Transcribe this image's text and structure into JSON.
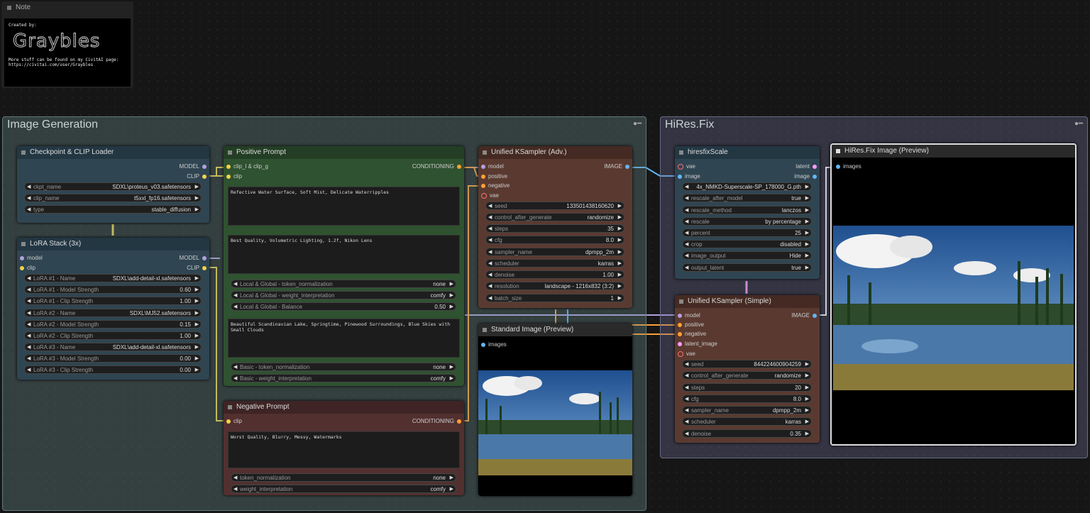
{
  "colors": {
    "clip": "#f2d24a",
    "model": "#b4a0e0",
    "conditioning": "#ffa030",
    "image": "#64b5f6",
    "latent": "#ff9cf9",
    "vae": "#ff6e6e"
  },
  "note": {
    "title": "Note",
    "created_by": "Created by:",
    "logo_text": "Graybles",
    "line1": "More stuff can be found on my CivitAI page:",
    "line2": "https://civitai.com/user/Graybles"
  },
  "groups": {
    "image_generation": "Image Generation",
    "hires_fix": "HiRes.Fix"
  },
  "checkpoint": {
    "title": "Checkpoint & CLIP Loader",
    "out_model": "MODEL",
    "out_clip": "CLIP",
    "widgets": [
      {
        "label": "ckpt_name",
        "value": "SDXL\\proteus_v03.safetensors"
      },
      {
        "label": "clip_name",
        "value": "t5xxl_fp16.safetensors"
      },
      {
        "label": "type",
        "value": "stable_diffusion"
      }
    ]
  },
  "lora": {
    "title": "LoRA Stack (3x)",
    "in_model": "model",
    "in_clip": "clip",
    "out_model": "MODEL",
    "out_clip": "CLIP",
    "widgets": [
      {
        "label": "LoRA #1 - Name",
        "value": "SDXL\\add-detail-xl.safetensors"
      },
      {
        "label": "LoRA #1 - Model Strength",
        "value": "0.60"
      },
      {
        "label": "LoRA #1 - Clip Strength",
        "value": "1.00"
      },
      {
        "label": "LoRA #2 - Name",
        "value": "SDXL\\MJ52.safetensors"
      },
      {
        "label": "LoRA #2 - Model Strength",
        "value": "0.15"
      },
      {
        "label": "LoRA #2 - Clip Strength",
        "value": "1.00"
      },
      {
        "label": "LoRA #3 - Name",
        "value": "SDXL\\add-detail-xl.safetensors"
      },
      {
        "label": "LoRA #3 - Model Strength",
        "value": "0.00"
      },
      {
        "label": "LoRA #3 - Clip Strength",
        "value": "0.00"
      }
    ]
  },
  "positive": {
    "title": "Positive Prompt",
    "in1": "clip_l & clip_g",
    "in2": "clip",
    "out": "CONDITIONING",
    "text1": "Refective Water Surface, Soft Mist, Delicate Waterripples",
    "text2": "Best Quality, Volumetric Lighting, 1.2f, Nikon Lens",
    "text3": "Beautiful Scandinavian Lake, Springtime, Pinewood Surroundings, Blue Skies with Small Clouds",
    "widgets_a": [
      {
        "label": "Local & Global - token_normalization",
        "value": "none"
      },
      {
        "label": "Local & Global - weight_interpretation",
        "value": "comfy"
      },
      {
        "label": "Local & Global - Balance",
        "value": "0.50"
      }
    ],
    "widgets_b": [
      {
        "label": "Basic - token_normalization",
        "value": "none"
      },
      {
        "label": "Basic - weight_interpretation",
        "value": "comfy"
      }
    ]
  },
  "negative": {
    "title": "Negative Prompt",
    "in": "clip",
    "out": "CONDITIONING",
    "text": "Worst Quality, Blurry, Messy, Watermarks",
    "widgets": [
      {
        "label": "token_normalization",
        "value": "none"
      },
      {
        "label": "weight_interpretation",
        "value": "comfy"
      }
    ]
  },
  "ksampler_adv": {
    "title": "Unified KSampler (Adv.)",
    "inputs": [
      "model",
      "positive",
      "negative",
      "vae"
    ],
    "out": "IMAGE",
    "widgets": [
      {
        "label": "seed",
        "value": "133501438160620"
      },
      {
        "label": "control_after_generate",
        "value": "randomize"
      },
      {
        "label": "steps",
        "value": "35"
      },
      {
        "label": "cfg",
        "value": "8.0"
      },
      {
        "label": "sampler_name",
        "value": "dpmpp_2m"
      },
      {
        "label": "scheduler",
        "value": "karras"
      },
      {
        "label": "denoise",
        "value": "1.00"
      },
      {
        "label": "resolution",
        "value": "landscape - 1216x832 (3:2)"
      },
      {
        "label": "batch_size",
        "value": "1"
      }
    ]
  },
  "standard_preview": {
    "title": "Standard Image (Preview)",
    "in": "images"
  },
  "hiresfix_scale": {
    "title": "hiresfixScale",
    "in_vae": "vae",
    "in_image": "image",
    "out_latent": "latent",
    "out_image": "image",
    "widgets": [
      {
        "label": "upscale_model",
        "value": "4x_NMKD-Superscale-SP_178000_G.pth"
      },
      {
        "label": "rescale_after_model",
        "value": "true"
      },
      {
        "label": "rescale_method",
        "value": "lanczos"
      },
      {
        "label": "rescale",
        "value": "by percentage"
      },
      {
        "label": "percent",
        "value": "25"
      },
      {
        "label": "crop",
        "value": "disabled"
      },
      {
        "label": "image_output",
        "value": "Hide"
      },
      {
        "label": "output_latent",
        "value": "true"
      }
    ]
  },
  "ksampler_simple": {
    "title": "Unified KSampler (Simple)",
    "inputs": [
      "model",
      "positive",
      "negative",
      "latent_image",
      "vae"
    ],
    "out": "IMAGE",
    "widgets": [
      {
        "label": "seed",
        "value": "844224600904259"
      },
      {
        "label": "control_after_generate",
        "value": "randomize"
      },
      {
        "label": "steps",
        "value": "20"
      },
      {
        "label": "cfg",
        "value": "8.0"
      },
      {
        "label": "sampler_name",
        "value": "dpmpp_2m"
      },
      {
        "label": "scheduler",
        "value": "karras"
      },
      {
        "label": "denoise",
        "value": "0.35"
      }
    ]
  },
  "hires_preview": {
    "title": "HiRes.Fix Image (Preview)",
    "in": "images"
  }
}
